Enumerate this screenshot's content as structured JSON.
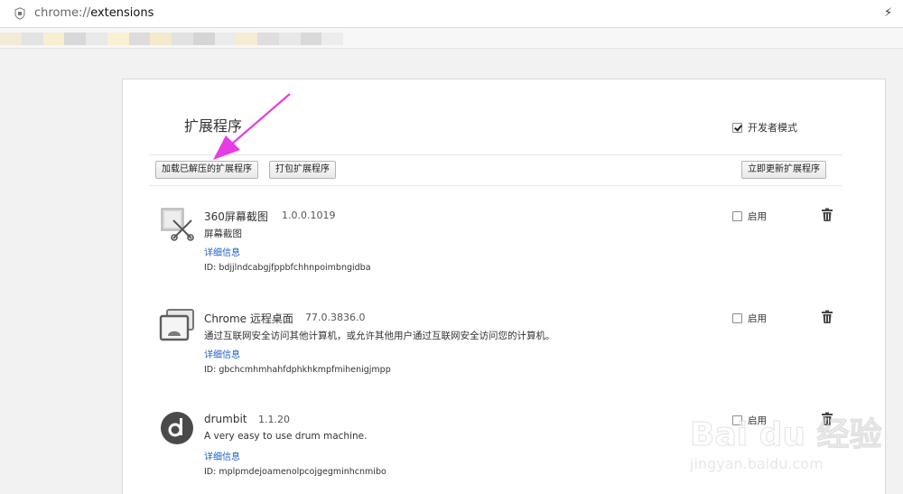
{
  "address_bar": {
    "scheme": "chrome://",
    "path": "extensions",
    "shield_icon": "shield-icon",
    "bolt_icon": "lightning-icon"
  },
  "page": {
    "title": "扩展程序",
    "developer_mode": {
      "label": "开发者模式",
      "checked": true
    },
    "buttons": {
      "load_unpacked": "加载已解压的扩展程序",
      "pack": "打包扩展程序",
      "update_now": "立即更新扩展程序"
    }
  },
  "extensions": [
    {
      "name": "360屏幕截图",
      "version": "1.0.0.1019",
      "description": "屏幕截图",
      "details_label": "详细信息",
      "id_text": "ID: bdjjlndcabgjfppbfchhnpoimbngidba",
      "enable_label": "启用",
      "icon": "screenshot-tool-icon"
    },
    {
      "name": "Chrome 远程桌面",
      "version": "77.0.3836.0",
      "description": "通过互联网安全访问其他计算机，或允许其他用户通过互联网安全访问您的计算机。",
      "details_label": "详细信息",
      "id_text": "ID: gbchcmhmhahfdphkhkmpfmihenigjmpp",
      "enable_label": "启用",
      "icon": "remote-desktop-icon"
    },
    {
      "name": "drumbit",
      "version": "1.1.20",
      "description": "A very easy to use drum machine.",
      "details_label": "详细信息",
      "id_text": "ID: mplpmdejoamenolpcojgegminhcnmibo",
      "enable_label": "启用",
      "icon": "drumbit-d-icon"
    }
  ],
  "watermark": {
    "logo_text": "Bai du 经验",
    "url_text": "jingyan.baidu.com"
  },
  "colors": {
    "link": "#1a5fc9",
    "arrow": "#e63ce6"
  }
}
